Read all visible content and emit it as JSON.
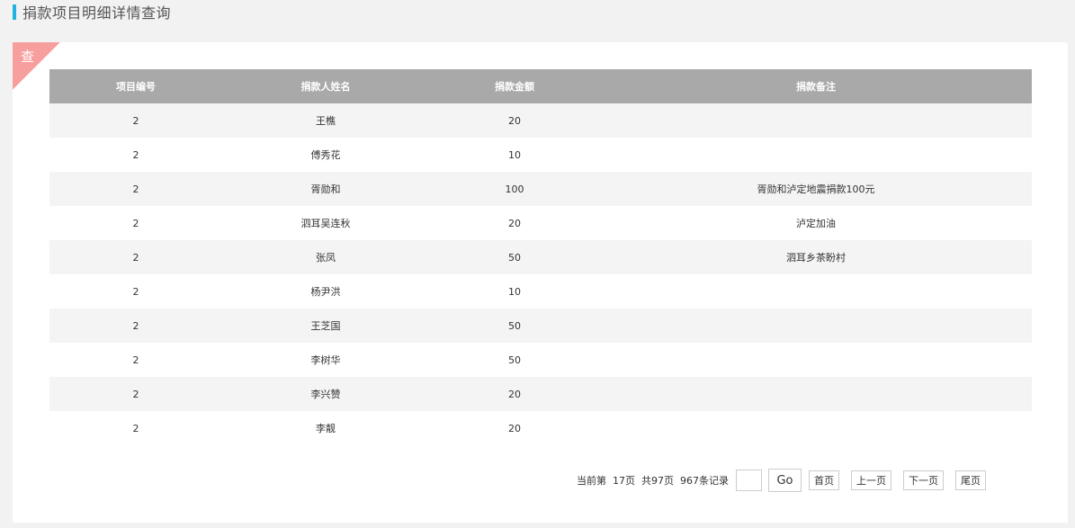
{
  "header": {
    "title": "捐款项目明细详情查询"
  },
  "panel": {
    "corner_label": "查"
  },
  "table": {
    "columns": [
      "项目编号",
      "捐款人姓名",
      "捐款金额",
      "捐款备注"
    ],
    "rows": [
      [
        "2",
        "王樵",
        "20",
        ""
      ],
      [
        "2",
        "傅秀花",
        "10",
        ""
      ],
      [
        "2",
        "胥勋和",
        "100",
        "胥勋和泸定地震捐款100元"
      ],
      [
        "2",
        "泗耳吴连秋",
        "20",
        "泸定加油"
      ],
      [
        "2",
        "张凤",
        "50",
        "泗耳乡茶盼村"
      ],
      [
        "2",
        "杨尹洪",
        "10",
        ""
      ],
      [
        "2",
        "王芝国",
        "50",
        ""
      ],
      [
        "2",
        "李树华",
        "50",
        ""
      ],
      [
        "2",
        "李兴赞",
        "20",
        ""
      ],
      [
        "2",
        "李靓",
        "20",
        ""
      ]
    ]
  },
  "pager": {
    "current_label": "当前第",
    "current_page": "17页",
    "total_pages": "共97页",
    "total_records": "967条记录",
    "page_input_value": "",
    "go_label": "Go",
    "first_label": "首页",
    "prev_label": "上一页",
    "next_label": "下一页",
    "last_label": "尾页"
  }
}
